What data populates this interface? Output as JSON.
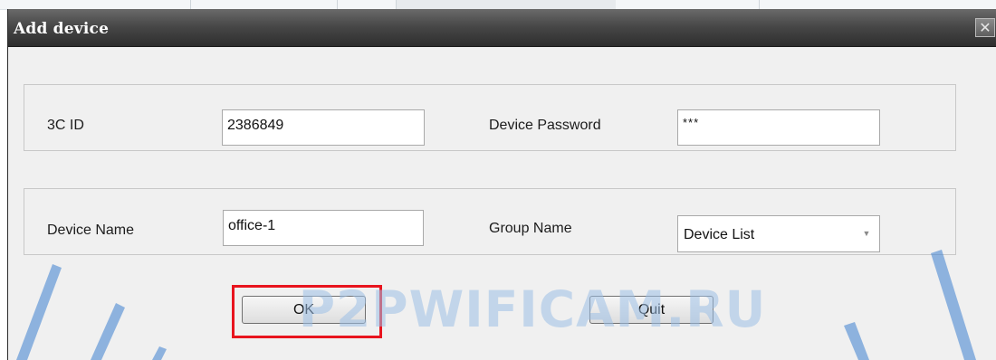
{
  "dialog": {
    "title": "Add device",
    "close_glyph": "✕"
  },
  "fields": {
    "id_label": "3C ID",
    "id_value": "2386849",
    "password_label": "Device Password",
    "password_value": "***",
    "name_label": "Device Name",
    "name_value": "office-1",
    "group_label": "Group Name",
    "group_value": "Device List"
  },
  "buttons": {
    "ok": "OK",
    "quit": "Quit"
  },
  "watermark": {
    "text": "P2PWIFICAM.RU"
  },
  "colors": {
    "highlight": "#e8141e",
    "watermark": "#9cc0e6"
  }
}
